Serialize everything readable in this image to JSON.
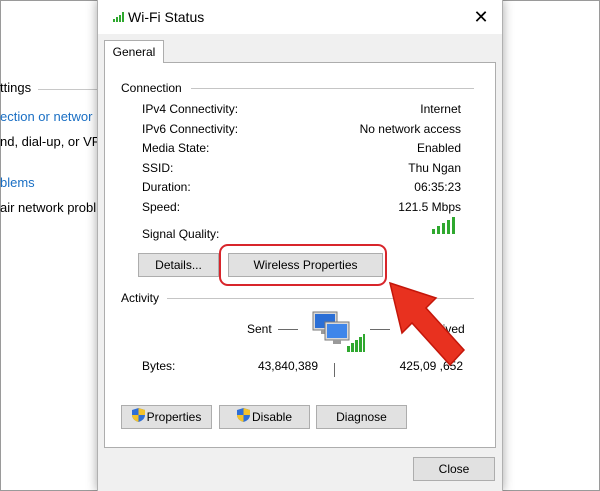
{
  "background": {
    "lines": [
      "ttings",
      "ection or networ",
      "nd, dial-up, or VP",
      "blems",
      "air network probl"
    ]
  },
  "dialog": {
    "title": "Wi-Fi Status",
    "close_glyph": "✕",
    "tab": "General",
    "connection": {
      "heading": "Connection",
      "rows": [
        {
          "label": "IPv4 Connectivity:",
          "value": "Internet"
        },
        {
          "label": "IPv6 Connectivity:",
          "value": "No network access"
        },
        {
          "label": "Media State:",
          "value": "Enabled"
        },
        {
          "label": "SSID:",
          "value": "Thu Ngan"
        },
        {
          "label": "Duration:",
          "value": "06:35:23"
        },
        {
          "label": "Speed:",
          "value": "121.5 Mbps"
        }
      ],
      "signal_label": "Signal Quality:",
      "signal_bars_filled": 5,
      "signal_bars_total": 5
    },
    "buttons": {
      "details": "Details...",
      "wireless_properties": "Wireless Properties",
      "properties": "Properties",
      "disable": "Disable",
      "diagnose": "Diagnose",
      "close": "Close"
    },
    "activity": {
      "heading": "Activity",
      "sent_label": "Sent",
      "received_label": "eived",
      "bytes_label": "Bytes:",
      "bytes_sent": "43,840,389",
      "bytes_received": "425,09 ,652"
    }
  },
  "colors": {
    "highlight": "#d8252b",
    "arrow": "#e8311f",
    "signal": "#2fa82f",
    "link": "#1a6fc4"
  }
}
